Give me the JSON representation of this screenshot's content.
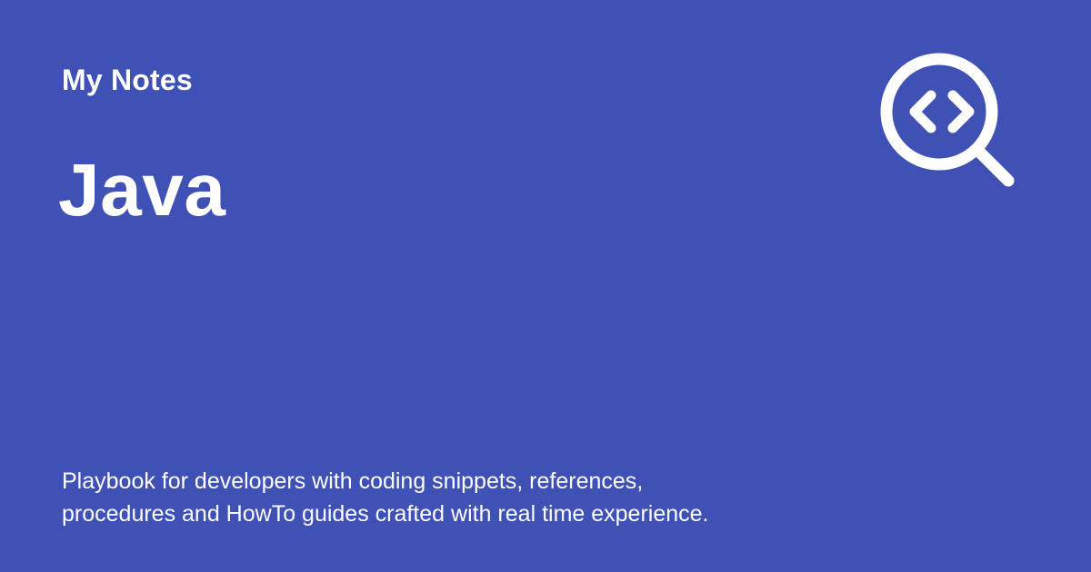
{
  "header": {
    "site_name": "My Notes",
    "page_title": "Java"
  },
  "footer": {
    "description_line1": "Playbook for developers with coding snippets, references,",
    "description_line2": "procedures and HowTo guides crafted with real time experience."
  },
  "logo": {
    "icon": "code-search-icon"
  },
  "colors": {
    "background": "#3f51b5",
    "foreground": "#ffffff"
  }
}
